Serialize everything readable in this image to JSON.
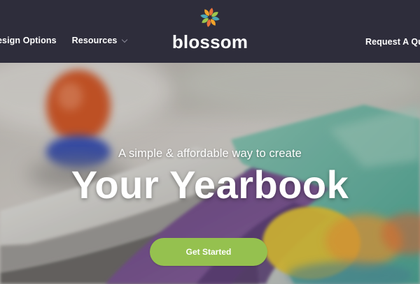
{
  "nav": {
    "left_items": [
      {
        "label": "esign Options"
      },
      {
        "label": "Resources"
      }
    ],
    "right_item": {
      "label": "Request A Quote"
    }
  },
  "logo": {
    "text": "blossom"
  },
  "hero": {
    "tagline": "A simple & affordable way to create",
    "title": "Your Yearbook",
    "cta_label": "Get Started"
  },
  "colors": {
    "nav_background": "#2e2d3b",
    "cta_background": "#95c14f",
    "logo_petals": [
      "#e8723a",
      "#9cc74e",
      "#4ba6b5",
      "#f0a32b"
    ]
  }
}
